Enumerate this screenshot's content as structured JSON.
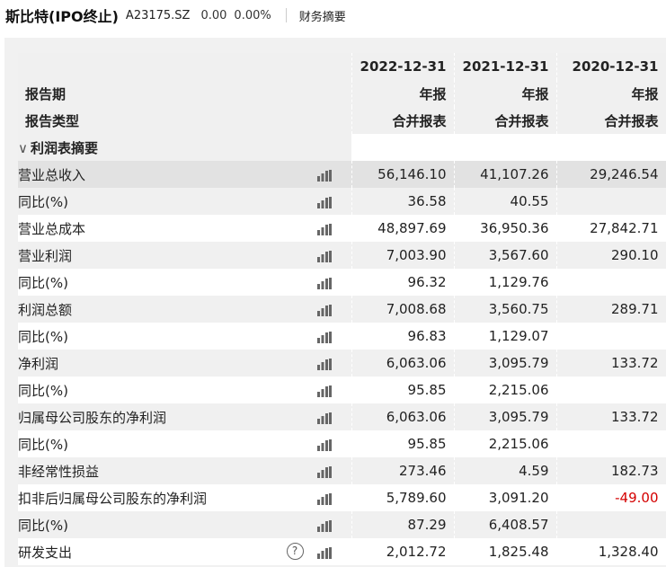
{
  "header": {
    "name": "斯比特(IPO终止)",
    "code": "A23175.SZ",
    "price": "0.00",
    "change": "0.00%",
    "tab": "财务摘要"
  },
  "columns": {
    "period_label": "报告期",
    "type_label": "报告类型",
    "periods": [
      "2022-12-31",
      "2021-12-31",
      "2020-12-31"
    ],
    "kinds": [
      "年报",
      "年报",
      "年报"
    ],
    "consol": [
      "合并报表",
      "合并报表",
      "合并报表"
    ]
  },
  "section": {
    "caret": "∨",
    "label": "利润表摘要"
  },
  "rows": [
    {
      "label": "营业总收入",
      "values": [
        "56,146.10",
        "41,107.26",
        "29,246.54"
      ]
    },
    {
      "label": "同比(%)",
      "values": [
        "36.58",
        "40.55",
        ""
      ]
    },
    {
      "label": "营业总成本",
      "values": [
        "48,897.69",
        "36,950.36",
        "27,842.71"
      ]
    },
    {
      "label": "营业利润",
      "values": [
        "7,003.90",
        "3,567.60",
        "290.10"
      ]
    },
    {
      "label": "同比(%)",
      "values": [
        "96.32",
        "1,129.76",
        ""
      ]
    },
    {
      "label": "利润总额",
      "values": [
        "7,008.68",
        "3,560.75",
        "289.71"
      ]
    },
    {
      "label": "同比(%)",
      "values": [
        "96.83",
        "1,129.07",
        ""
      ]
    },
    {
      "label": "净利润",
      "values": [
        "6,063.06",
        "3,095.79",
        "133.72"
      ]
    },
    {
      "label": "同比(%)",
      "values": [
        "95.85",
        "2,215.06",
        ""
      ]
    },
    {
      "label": "归属母公司股东的净利润",
      "values": [
        "6,063.06",
        "3,095.79",
        "133.72"
      ]
    },
    {
      "label": "同比(%)",
      "values": [
        "95.85",
        "2,215.06",
        ""
      ]
    },
    {
      "label": "非经常性损益",
      "values": [
        "273.46",
        "4.59",
        "182.73"
      ]
    },
    {
      "label": "扣非后归属母公司股东的净利润",
      "values": [
        "5,789.60",
        "3,091.20",
        "-49.00"
      ]
    },
    {
      "label": "同比(%)",
      "values": [
        "87.29",
        "6,408.57",
        ""
      ]
    },
    {
      "label": "研发支出",
      "values": [
        "2,012.72",
        "1,825.48",
        "1,328.40"
      ]
    }
  ],
  "help_glyph": "?",
  "colors": {
    "negative": "#d40000",
    "highlight": "#e2e2e2",
    "stripe": "#f0f0f0"
  },
  "icons": {
    "chart": "bar-chart-icon",
    "help": "help-icon",
    "expand": "chevron-down-icon"
  }
}
